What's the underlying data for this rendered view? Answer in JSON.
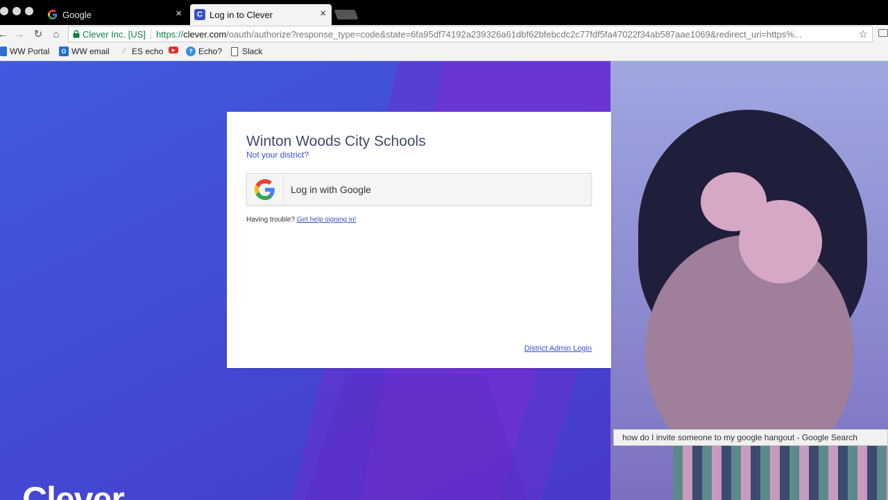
{
  "browser": {
    "tabs": [
      {
        "title": "Google",
        "favicon": "google-g-icon",
        "active": false
      },
      {
        "title": "Log in to Clever",
        "favicon": "clever-c-icon",
        "active": true
      }
    ],
    "close_glyph": "×",
    "address": {
      "security_label": "Clever Inc. [US]",
      "url_scheme": "https://",
      "url_host": "clever.com",
      "url_rest": "/oauth/authorize?response_type=code&state=6fa95df74192a239326a61dbf62bfebcdc2c77fdf5fa47022f34ab587aae1069&redirect_uri=https%..."
    },
    "nav_icons": {
      "back": "←",
      "forward": "→",
      "reload": "↻",
      "home": "⌂",
      "star": "☆"
    },
    "bookmarks": [
      {
        "label": "WW Portal",
        "icon": "portal-icon"
      },
      {
        "label": "WW email",
        "icon": "outlook-icon"
      },
      {
        "label": "ES echo",
        "icon": "echo-icon"
      },
      {
        "label": "",
        "icon": "youtube-icon"
      },
      {
        "label": "Echo?",
        "icon": "help-icon"
      },
      {
        "label": "Slack",
        "icon": "page-icon"
      }
    ]
  },
  "login": {
    "district_name": "Winton Woods City Schools",
    "not_district_link": "Not your district?",
    "google_button_label": "Log in with Google",
    "trouble_text": "Having trouble?",
    "help_link": "Get help signing in!",
    "admin_link": "District Admin Login"
  },
  "brand": {
    "logo_text": "Clever"
  },
  "notification": {
    "text": "how do I invite someone to my google hangout - Google Search"
  },
  "colors": {
    "page_bg": "#4a4fe0",
    "link": "#3a4fc9",
    "secure_green": "#0b8043"
  }
}
